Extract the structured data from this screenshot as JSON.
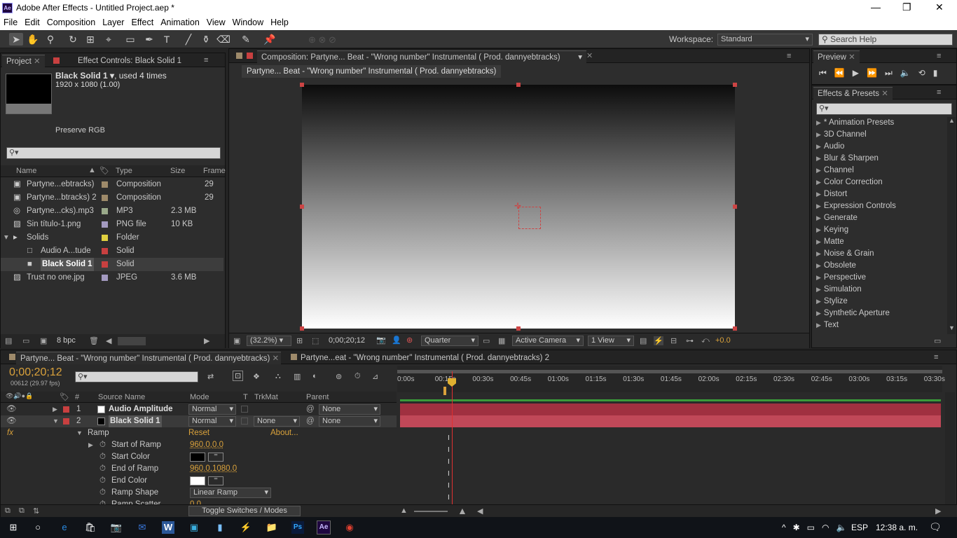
{
  "window": {
    "title": "Adobe After Effects - Untitled Project.aep *",
    "app_badge": "Ae",
    "minimize": "—",
    "restore": "❐",
    "close": "✕"
  },
  "menu": [
    "File",
    "Edit",
    "Composition",
    "Layer",
    "Effect",
    "Animation",
    "View",
    "Window",
    "Help"
  ],
  "workspace": {
    "label": "Workspace:",
    "value": "Standard"
  },
  "search_help": {
    "placeholder": "Search Help"
  },
  "project_panel": {
    "tab": "Project",
    "tab2": "Effect Controls: Black Solid 1",
    "item_name": "Black Solid 1 ▾",
    "item_used": ", used 4 times",
    "item_dims": "1920 x 1080 (1.00)",
    "item_color": "Preserve RGB",
    "columns": [
      "Name",
      "Type",
      "Size",
      "Frame"
    ],
    "rows": [
      {
        "name": "Partyne...ebtracks)",
        "type": "Composition",
        "size": "",
        "frame": "29",
        "color": "#9e8a6a"
      },
      {
        "name": "Partyne...btracks) 2",
        "type": "Composition",
        "size": "",
        "frame": "29",
        "color": "#9e8a6a"
      },
      {
        "name": "Partyne...cks).mp3",
        "type": "MP3",
        "size": "2.3 MB",
        "frame": "",
        "color": "#9aa98a"
      },
      {
        "name": "Sin título-1.png",
        "type": "PNG file",
        "size": "10 KB",
        "frame": "",
        "color": "#a39ac0"
      },
      {
        "name": "Solids",
        "type": "Folder",
        "size": "",
        "frame": "",
        "color": "#e0d040"
      },
      {
        "name": "Audio A...tude",
        "type": "Solid",
        "size": "",
        "frame": "",
        "color": "#c84040"
      },
      {
        "name": "Black Solid 1",
        "type": "Solid",
        "size": "",
        "frame": "",
        "color": "#c84040"
      },
      {
        "name": "Trust no one.jpg",
        "type": "JPEG",
        "size": "3.6 MB",
        "frame": "",
        "color": "#a39ac0"
      }
    ],
    "bpc": "8 bpc"
  },
  "comp_panel": {
    "tab": "Composition: Partyne... Beat - \"Wrong number\" Instrumental  ( Prod. dannyebtracks)",
    "breadcrumb": "Partyne... Beat - \"Wrong number\" Instrumental  ( Prod. dannyebtracks)",
    "zoom": "(32.2%)",
    "timecode": "0;00;20;12",
    "resolution": "Quarter",
    "camera": "Active Camera",
    "views": "1 View",
    "exposure": "+0.0"
  },
  "preview_panel": {
    "tab": "Preview"
  },
  "effects_panel": {
    "tab": "Effects & Presets",
    "items": [
      "* Animation Presets",
      "3D Channel",
      "Audio",
      "Blur & Sharpen",
      "Channel",
      "Color Correction",
      "Distort",
      "Expression Controls",
      "Generate",
      "Keying",
      "Matte",
      "Noise & Grain",
      "Obsolete",
      "Perspective",
      "Simulation",
      "Stylize",
      "Synthetic Aperture",
      "Text"
    ]
  },
  "timeline": {
    "tab1": "Partyne... Beat - \"Wrong number\" Instrumental  ( Prod. dannyebtracks)",
    "tab2": "Partyne...eat - \"Wrong number\" Instrumental  ( Prod. dannyebtracks) 2",
    "timecode": "0;00;20;12",
    "frames": "00612 (29.97 fps)",
    "cols": {
      "num": "#",
      "source": "Source Name",
      "mode": "Mode",
      "t": "T",
      "trkmat": "TrkMat",
      "parent": "Parent"
    },
    "layers": [
      {
        "num": "1",
        "name": "Audio Amplitude",
        "mode": "Normal",
        "trkmat": "",
        "parent": "None"
      },
      {
        "num": "2",
        "name": "Black Solid 1",
        "mode": "Normal",
        "trkmat": "None",
        "parent": "None"
      }
    ],
    "fx": "fx",
    "effect": "Ramp",
    "reset": "Reset",
    "about": "About...",
    "props": [
      {
        "name": "Start of Ramp",
        "value": "960.0,0.0"
      },
      {
        "name": "Start Color",
        "value": ""
      },
      {
        "name": "End of Ramp",
        "value": "960.0,1080.0"
      },
      {
        "name": "End Color",
        "value": ""
      },
      {
        "name": "Ramp Shape",
        "value": "Linear Ramp"
      },
      {
        "name": "Ramp Scatter",
        "value": "0.0"
      }
    ],
    "ruler": [
      "0:00s",
      "00:15s",
      "00:30s",
      "00:45s",
      "01:00s",
      "01:15s",
      "01:30s",
      "01:45s",
      "02:00s",
      "02:15s",
      "02:30s",
      "02:45s",
      "03:00s",
      "03:15s",
      "03:30s"
    ],
    "toggle": "Toggle Switches / Modes"
  },
  "taskbar": {
    "lang": "ESP",
    "time": "12:38 a. m."
  }
}
